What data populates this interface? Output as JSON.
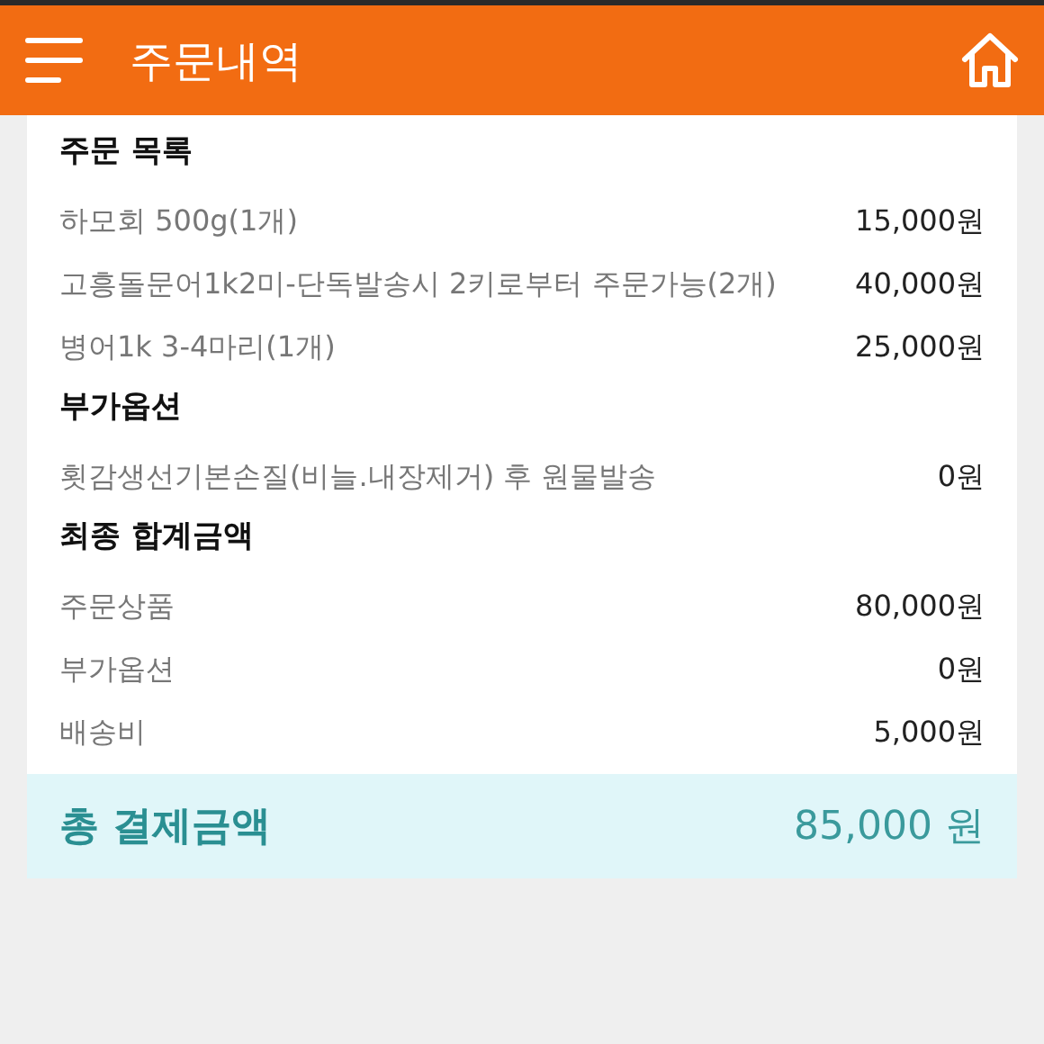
{
  "header": {
    "title": "주문내역"
  },
  "sections": [
    {
      "title": "주문 목록",
      "rows": [
        {
          "label": "하모회 500g(1개)",
          "value": "15,000원"
        },
        {
          "label": "고흥돌문어1k2미-단독발송시 2키로부터 주문가능(2개)",
          "value": "40,000원"
        },
        {
          "label": "병어1k 3-4마리(1개)",
          "value": "25,000원"
        }
      ]
    },
    {
      "title": "부가옵션",
      "rows": [
        {
          "label": "횟감생선기본손질(비늘.내장제거) 후 원물발송",
          "value": "0원"
        }
      ]
    },
    {
      "title": "최종 합계금액",
      "rows": [
        {
          "label": "주문상품",
          "value": "80,000원"
        },
        {
          "label": "부가옵션",
          "value": "0원"
        },
        {
          "label": "배송비",
          "value": "5,000원"
        }
      ]
    }
  ],
  "total": {
    "label": "총 결제금액",
    "value": "85,000 원"
  }
}
